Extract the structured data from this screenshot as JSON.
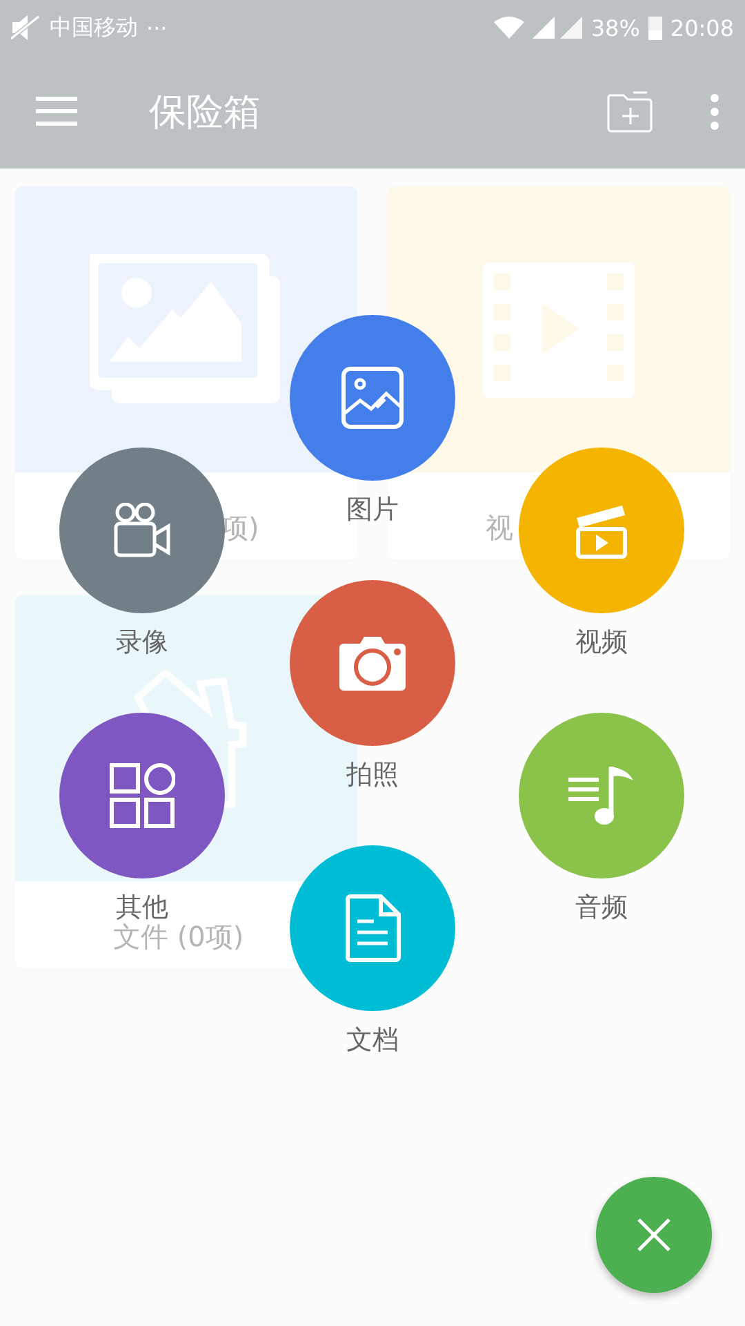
{
  "status_bar": {
    "carrier": "中国移动",
    "more": "···",
    "battery": "38%",
    "time": "20:08"
  },
  "app_bar": {
    "title": "保险箱"
  },
  "cards": [
    {
      "kind": "images",
      "color": "#eaf1fd",
      "label": "项)"
    },
    {
      "kind": "videos",
      "color": "#fff8e6",
      "label": "视"
    },
    {
      "kind": "files",
      "color": "#e5f6fb",
      "label": "文件 (0项)"
    }
  ],
  "menu": [
    {
      "kind": "image",
      "color": "#437eeb",
      "label": "图片"
    },
    {
      "kind": "recorder",
      "color": "#737f87",
      "label": "录像"
    },
    {
      "kind": "clapper",
      "color": "#f4b400",
      "label": "视频"
    },
    {
      "kind": "camera",
      "color": "#d85f45",
      "label": "拍照"
    },
    {
      "kind": "grid",
      "color": "#7e57c2",
      "label": "其他"
    },
    {
      "kind": "music",
      "color": "#8bc34a",
      "label": "音频"
    },
    {
      "kind": "document",
      "color": "#00bcd4",
      "label": "文档"
    }
  ],
  "fab": {
    "kind": "close",
    "color": "#4caf50"
  }
}
